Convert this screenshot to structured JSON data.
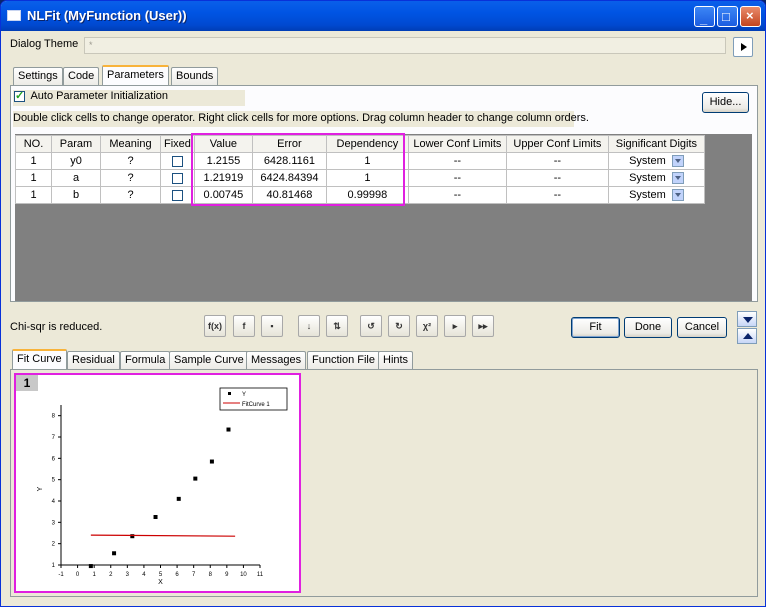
{
  "window": {
    "title": "NLFit (MyFunction (User))"
  },
  "dialog_theme": {
    "label": "Dialog Theme",
    "value": "*"
  },
  "top_tabs": [
    "Settings",
    "Code",
    "Parameters",
    "Bounds"
  ],
  "auto_param": {
    "label": "Auto Parameter Initialization",
    "checked": true
  },
  "hint": "Double click cells to change operator. Right click cells for more options. Drag column header to change column orders.",
  "hide_button": "Hide...",
  "table": {
    "headers": [
      "NO.",
      "Param",
      "Meaning",
      "Fixed",
      "Value",
      "Error",
      "Dependency",
      "Lower Conf Limits",
      "Upper Conf Limits",
      "Significant Digits"
    ],
    "rows": [
      {
        "no": "1",
        "param": "y0",
        "meaning": "?",
        "value": "1.2155",
        "error": "6428.1161",
        "dependency": "1",
        "lower": "--",
        "upper": "--",
        "digits": "System"
      },
      {
        "no": "1",
        "param": "a",
        "meaning": "?",
        "value": "1.21919",
        "error": "6424.84394",
        "dependency": "1",
        "lower": "--",
        "upper": "--",
        "digits": "System"
      },
      {
        "no": "1",
        "param": "b",
        "meaning": "?",
        "value": "0.00745",
        "error": "40.81468",
        "dependency": "0.99998",
        "lower": "--",
        "upper": "--",
        "digits": "System"
      }
    ]
  },
  "status": "Chi-sqr is reduced.",
  "buttons": {
    "fit": "Fit",
    "done": "Done",
    "cancel": "Cancel"
  },
  "bottom_tabs": [
    "Fit Curve",
    "Residual",
    "Formula",
    "Sample Curve",
    "Messages",
    "Function File",
    "Hints"
  ],
  "graph": {
    "layer": "1",
    "legend": [
      "Y",
      "FitCurve 1"
    ],
    "xlabel": "X",
    "ylabel": "Y",
    "xticks": [
      "-1",
      "0",
      "1",
      "2",
      "3",
      "4",
      "5",
      "6",
      "7",
      "8",
      "9",
      "10",
      "11"
    ],
    "yticks": [
      "1",
      "2",
      "3",
      "4",
      "5",
      "6",
      "7",
      "8"
    ]
  },
  "chart_data": {
    "type": "scatter",
    "xlim": [
      -1,
      11
    ],
    "ylim": [
      1,
      8.5
    ],
    "series": [
      {
        "name": "Y",
        "x": [
          0.8,
          2.2,
          3.3,
          4.7,
          6.1,
          7.1,
          8.1,
          9.1
        ],
        "y": [
          0.95,
          1.55,
          2.35,
          3.25,
          4.1,
          5.05,
          5.85,
          7.35
        ]
      },
      {
        "name": "FitCurve 1",
        "x": [
          0.8,
          9.5
        ],
        "y": [
          2.4,
          2.35
        ]
      }
    ]
  },
  "colors": {
    "highlight": "#E020E0",
    "fit_line": "#CC0000"
  }
}
